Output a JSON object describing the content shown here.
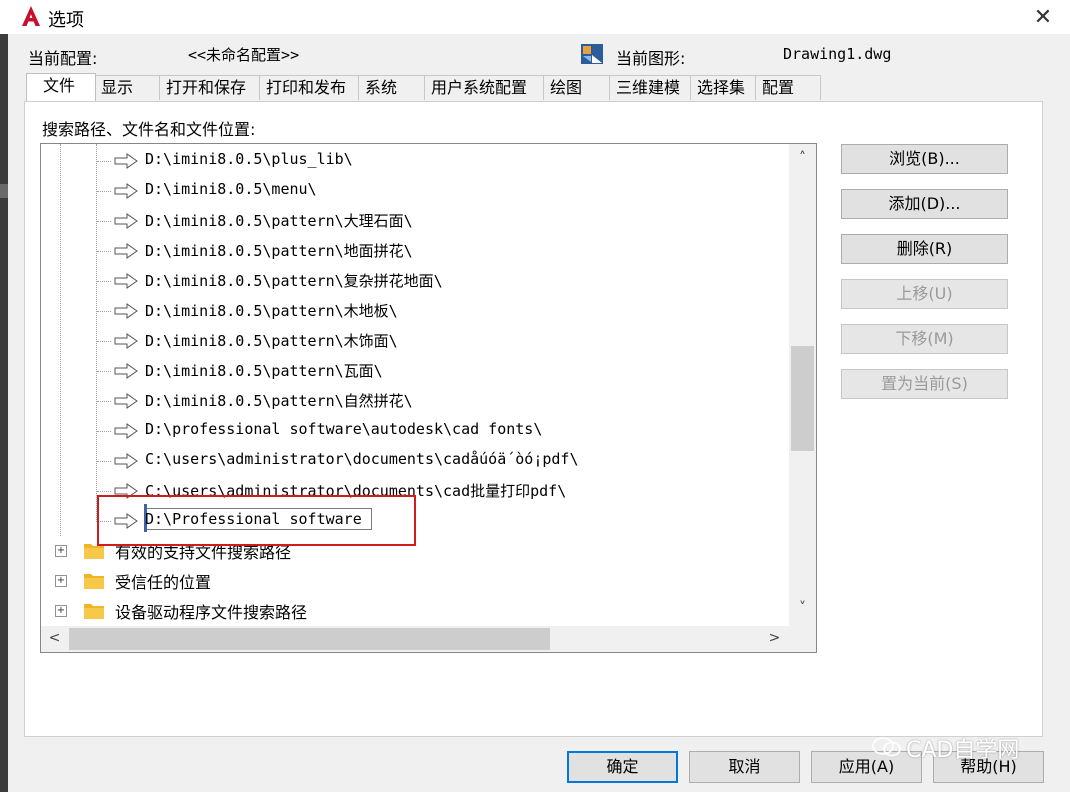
{
  "window": {
    "title": "选项",
    "close_glyph": "✕"
  },
  "current": {
    "profile_label": "当前配置:",
    "profile_value": "<<未命名配置>>",
    "drawing_label": "当前图形:",
    "drawing_value": "Drawing1.dwg"
  },
  "tabs": [
    {
      "label": "文件",
      "active": true
    },
    {
      "label": "显示"
    },
    {
      "label": "打开和保存"
    },
    {
      "label": "打印和发布"
    },
    {
      "label": "系统"
    },
    {
      "label": "用户系统配置"
    },
    {
      "label": "绘图"
    },
    {
      "label": "三维建模"
    },
    {
      "label": "选择集"
    },
    {
      "label": "配置"
    }
  ],
  "search_label": "搜索路径、文件名和文件位置:",
  "paths": [
    "D:\\imini8.0.5\\plus_lib\\",
    "D:\\imini8.0.5\\menu\\",
    "D:\\imini8.0.5\\pattern\\大理石面\\",
    "D:\\imini8.0.5\\pattern\\地面拼花\\",
    "D:\\imini8.0.5\\pattern\\复杂拼花地面\\",
    "D:\\imini8.0.5\\pattern\\木地板\\",
    "D:\\imini8.0.5\\pattern\\木饰面\\",
    "D:\\imini8.0.5\\pattern\\瓦面\\",
    "D:\\imini8.0.5\\pattern\\自然拼花\\",
    "D:\\professional software\\autodesk\\cad fonts\\",
    "C:\\users\\administrator\\documents\\cadåúóä´òó¡pdf\\",
    "C:\\users\\administrator\\documents\\cad批量打印pdf\\"
  ],
  "editing_path": "D:\\Professional software",
  "folders": [
    "有效的支持文件搜索路径",
    "受信任的位置",
    "设备驱动程序文件搜索路径"
  ],
  "scroll": {
    "up": "˄",
    "down": "˅",
    "left": "<",
    "right": ">"
  },
  "side_buttons": {
    "browse": "浏览(B)...",
    "add": "添加(D)...",
    "remove": "删除(R)",
    "move_up": "上移(U)",
    "move_down": "下移(M)",
    "set_current": "置为当前(S)"
  },
  "bottom_buttons": {
    "ok": "确定",
    "cancel": "取消",
    "apply": "应用(A)",
    "help": "帮助(H)"
  },
  "watermark": "CAD自学网",
  "colors": {
    "highlight": "#d01c1c",
    "logo_red": "#c8102e",
    "folder": "#f0b429"
  }
}
